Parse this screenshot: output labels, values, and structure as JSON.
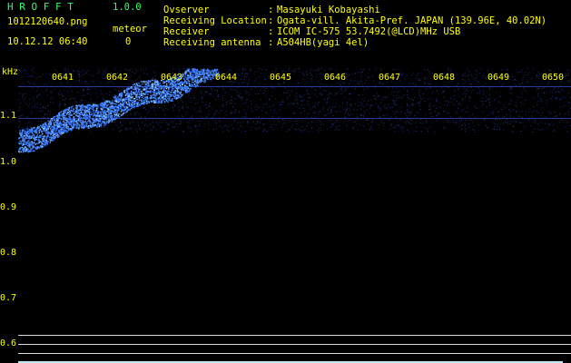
{
  "header": {
    "app_title": "H R O F F T",
    "app_version": "1.0.0",
    "file_name": "1012120640.png",
    "datetime": "10.12.12 06:40",
    "meteor_label": "meteor",
    "meteor_count": "0",
    "info": [
      {
        "label": "Ovserver",
        "value": "Masayuki Kobayashi"
      },
      {
        "label": "Receiving Location",
        "value": "Ogata-vill. Akita-Pref. JAPAN (139.96E, 40.02N)"
      },
      {
        "label": "Receiver",
        "value": "ICOM IC-575 53.7492(@LCD)MHz USB"
      },
      {
        "label": "Receiving antenna",
        "value": "A504HB(yagi 4el)"
      }
    ]
  },
  "spectrogram": {
    "y_unit": "kHz",
    "time_ticks": [
      "0641",
      "0642",
      "0643",
      "0644",
      "0645",
      "0646",
      "0647",
      "0648",
      "0649",
      "0650"
    ],
    "freq_ticks": [
      "1.1",
      "1.0",
      "0.9",
      "0.8",
      "0.7",
      "0.6"
    ],
    "colors": {
      "signal": "#3a7bff",
      "signal_bright": "#88c8ff",
      "text": "#ffff00",
      "title": "#33ff66"
    }
  }
}
